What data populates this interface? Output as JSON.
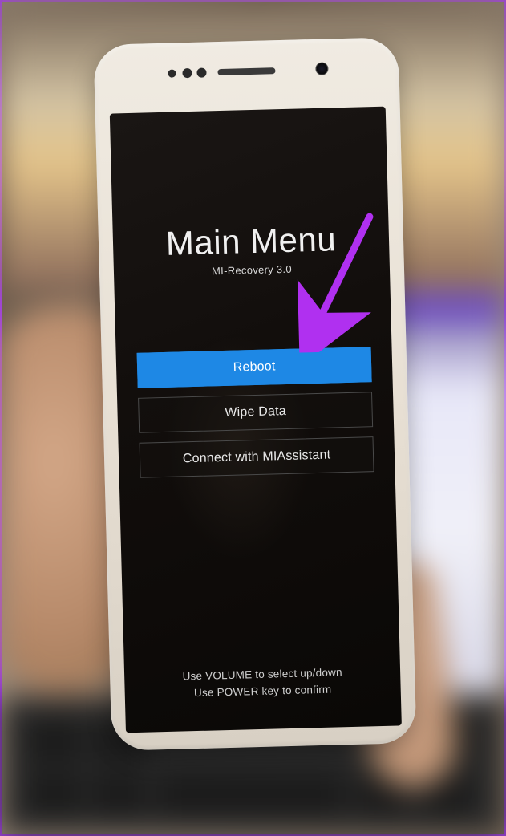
{
  "recovery": {
    "title": "Main Menu",
    "subtitle": "MI-Recovery 3.0",
    "menu": [
      {
        "label": "Reboot",
        "selected": true
      },
      {
        "label": "Wipe Data",
        "selected": false
      },
      {
        "label": "Connect with MIAssistant",
        "selected": false
      }
    ],
    "hint_line1": "Use VOLUME to select up/down",
    "hint_line2": "Use POWER key to confirm"
  },
  "annotation": {
    "arrow_color": "#b030f0"
  }
}
